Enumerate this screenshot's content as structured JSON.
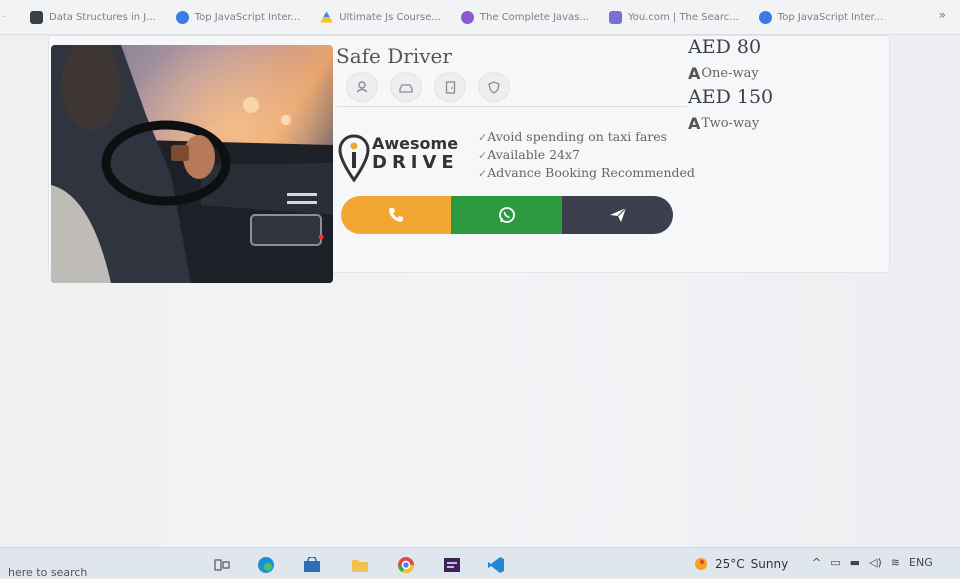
{
  "bookmarks": [
    {
      "label": "Data Structures in J...",
      "icon": "bookmark-dark-square-icon",
      "color": "#3a3e46"
    },
    {
      "label": "Top JavaScript Inter...",
      "icon": "globe-blue-icon",
      "color": "#3d7be3"
    },
    {
      "label": "Ultimate Js Course...",
      "icon": "drive-triangle-icon",
      "color": "#3a8ee8"
    },
    {
      "label": "The Complete Javas...",
      "icon": "purple-circle-icon",
      "color": "#8b59d6"
    },
    {
      "label": "You.com | The Searc...",
      "icon": "you-logo-icon",
      "color": "#7b6fd6"
    },
    {
      "label": "Top JavaScript Inter...",
      "icon": "globe-blue-icon",
      "color": "#3d7be3"
    }
  ],
  "bookmarks_more": "»",
  "card": {
    "title": "Safe Driver",
    "feature_icons": [
      "driver-icon",
      "car-icon",
      "door-icon",
      "shield-icon"
    ],
    "price_oneway": "AED 80",
    "label_oneway": "One-way",
    "price_twoway": "AED 150",
    "label_twoway": "Two-way",
    "price_letter": "A",
    "logo_top": "Awesome",
    "logo_bottom": "DRIVE",
    "features": [
      "Avoid spending on taxi fares",
      "Available 24x7",
      "Advance Booking Recommended"
    ],
    "actions": [
      {
        "name": "call",
        "icon": "phone-icon",
        "color": "#f1a731"
      },
      {
        "name": "whatsapp",
        "icon": "whatsapp-icon",
        "color": "#2e9a40"
      },
      {
        "name": "telegram",
        "icon": "send-icon",
        "color": "#3e3f4e"
      }
    ]
  },
  "taskbar": {
    "search_text": "here to search",
    "weather_temp": "25°C",
    "weather_desc": "Sunny",
    "language": "ENG"
  }
}
